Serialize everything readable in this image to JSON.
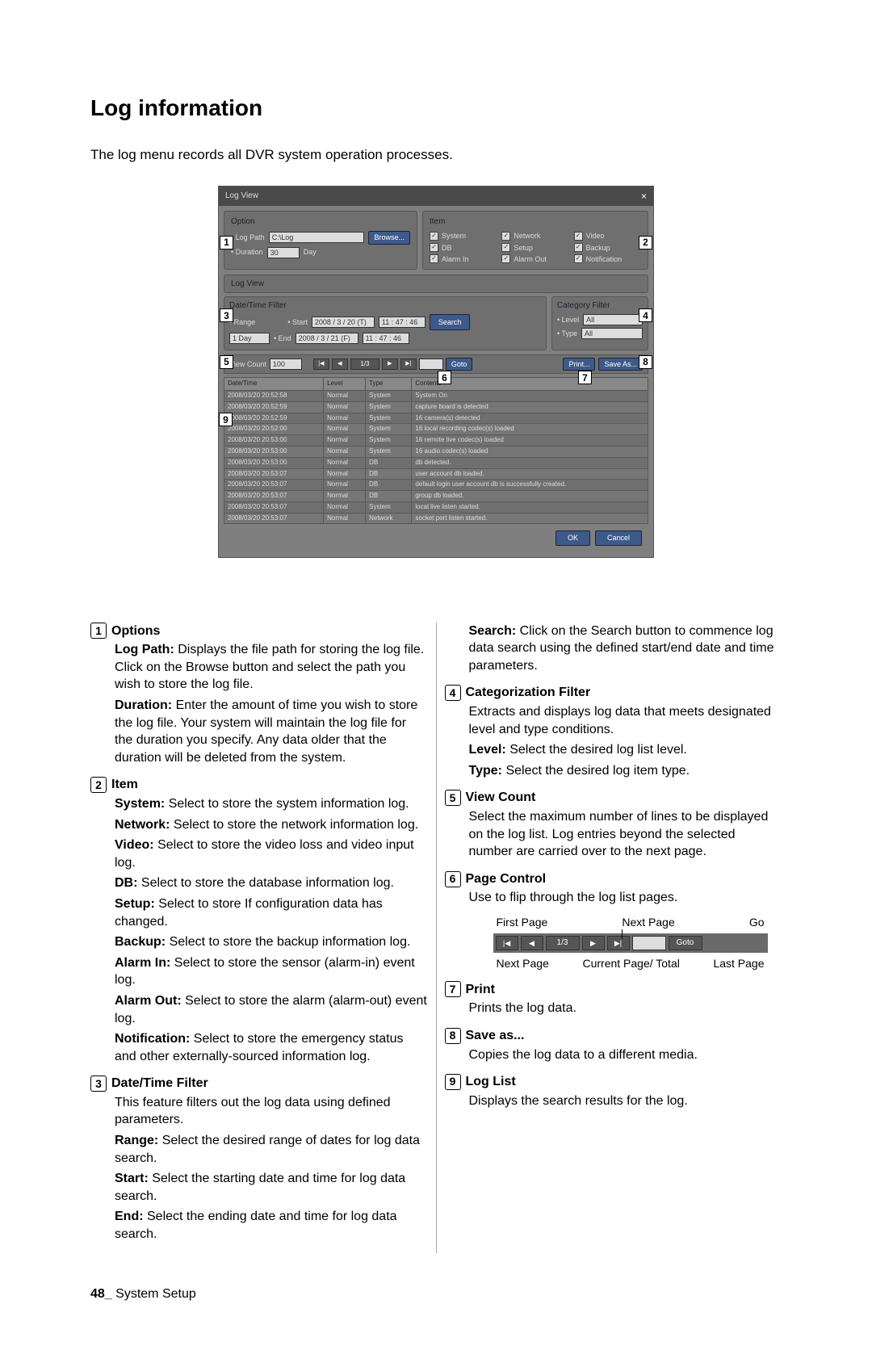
{
  "page_title": "Log information",
  "intro": "The log menu records all DVR system operation processes.",
  "footer": {
    "num": "48_",
    "label": "System Setup"
  },
  "shot": {
    "title": "Log View",
    "option": {
      "header": "Option",
      "log_path_lbl": "Log Path",
      "log_path_val": "C:\\Log",
      "browse": "Browse...",
      "duration_lbl": "Duration",
      "duration_val": "30",
      "duration_unit": "Day"
    },
    "item": {
      "header": "Item",
      "checks": [
        "System",
        "Network",
        "Video",
        "DB",
        "Setup",
        "Backup",
        "Alarm In",
        "Alarm Out",
        "Notification"
      ]
    },
    "logview_header": "Log View",
    "dt": {
      "header": "Date/Time Filter",
      "range_lbl": "Range",
      "range_val": "1 Day",
      "start_lbl": "Start",
      "start_date": "2008 / 3 / 20 (T)",
      "start_time": "11 : 47 : 46",
      "end_lbl": "End",
      "end_date": "2008 / 3 / 21 (F)",
      "end_time": "11 : 47 : 46",
      "search": "Search"
    },
    "cat": {
      "header": "Category Filter",
      "level_lbl": "Level",
      "level_val": "All",
      "type_lbl": "Type",
      "type_val": "All"
    },
    "countbar": {
      "view_count_lbl": "View Count",
      "view_count_val": "100",
      "page": "1/3",
      "goto": "Goto",
      "print": "Print...",
      "saveas": "Save As..."
    },
    "table": {
      "cols": [
        "Date/Time",
        "Level",
        "Type",
        "Contents"
      ],
      "rows": [
        [
          "2008/03/20 20:52:58",
          "Normal",
          "System",
          "System On"
        ],
        [
          "2008/03/20 20:52:59",
          "Normal",
          "System",
          "capture board is detected"
        ],
        [
          "2008/03/20 20:52:59",
          "Normal",
          "System",
          "16 camera(s) detected"
        ],
        [
          "2008/03/20 20:52:00",
          "Normal",
          "System",
          "16 local recording codec(s) loaded"
        ],
        [
          "2008/03/20 20:53:00",
          "Normal",
          "System",
          "16 remote live codec(s) loaded"
        ],
        [
          "2008/03/20 20:53:00",
          "Normal",
          "System",
          "16 audio codec(s) loaded"
        ],
        [
          "2008/03/20 20:53:00",
          "Normal",
          "DB",
          "db detected."
        ],
        [
          "2008/03/20 20:53:07",
          "Normal",
          "DB",
          "user account db loaded."
        ],
        [
          "2008/03/20 20:53:07",
          "Normal",
          "DB",
          "default login user account db is successfully created."
        ],
        [
          "2008/03/20 20:53:07",
          "Normal",
          "DB",
          "group db loaded."
        ],
        [
          "2008/03/20 20:53:07",
          "Normal",
          "System",
          "local live listen started."
        ],
        [
          "2008/03/20 20:53:07",
          "Normal",
          "Network",
          "socket port listen started."
        ]
      ]
    },
    "ok": "OK",
    "cancel": "Cancel"
  },
  "left": {
    "options": {
      "h": "Options",
      "log_path": "Log Path:",
      "log_path_txt": "Displays the file path for storing the log file. Click on the Browse button and select the path you wish to store the log file.",
      "duration": "Duration:",
      "duration_txt": "Enter the amount of time you wish to store the log file. Your system will maintain the log file for the duration you specify. Any data older that the duration will be deleted from the system."
    },
    "item": {
      "h": "Item",
      "system": "System:",
      "system_txt": "Select to store the system information log.",
      "network": "Network:",
      "network_txt": "Select to store the network information log.",
      "video": "Video:",
      "video_txt": "Select to store the video loss and video input log.",
      "db": "DB:",
      "db_txt": "Select to store the database information log.",
      "setup": "Setup:",
      "setup_txt": "Select to store If configuration data has changed.",
      "backup": "Backup:",
      "backup_txt": "Select to store the backup information log.",
      "alarmin": "Alarm In:",
      "alarmin_txt": "Select to store the sensor (alarm-in) event log.",
      "alarmout": "Alarm Out:",
      "alarmout_txt": "Select to store the alarm (alarm-out) event log.",
      "notif": "Notification:",
      "notif_txt": "Select to store the emergency status and other externally-sourced information log."
    },
    "dt": {
      "h": "Date/Time Filter",
      "txt": "This feature filters out the log data using defined parameters.",
      "range": "Range:",
      "range_txt": "Select the desired range of dates for log data search.",
      "start": "Start:",
      "start_txt": "Select the starting date and time for log data search.",
      "end": "End:",
      "end_txt": "Select the ending date and time for log data search."
    }
  },
  "right": {
    "search": "Search:",
    "search_txt": "Click on the Search button to commence log data search using the defined start/end date and time parameters.",
    "cat": {
      "h": "Categorization Filter",
      "txt": "Extracts and displays log data that meets designated level and type conditions.",
      "level": "Level:",
      "level_txt": "Select the desired log list level.",
      "type": "Type:",
      "type_txt": "Select the desired log item type."
    },
    "vc": {
      "h": "View Count",
      "txt": "Select the maximum number of lines to be displayed on the log list. Log entries beyond the selected number are carried over to the next page."
    },
    "pc": {
      "h": "Page Control",
      "txt": "Use to flip through the log list pages.",
      "first": "First Page",
      "next1": "Next Page",
      "go": "Go",
      "pageind": "1/3",
      "goto": "Goto",
      "next2": "Next Page",
      "cp": "Current Page/ Total",
      "last": "Last Page"
    },
    "print": {
      "h": "Print",
      "txt": "Prints the log data."
    },
    "save": {
      "h": "Save as...",
      "txt": "Copies the log data to a different media."
    },
    "list": {
      "h": "Log List",
      "txt": "Displays the search results for the log."
    }
  }
}
